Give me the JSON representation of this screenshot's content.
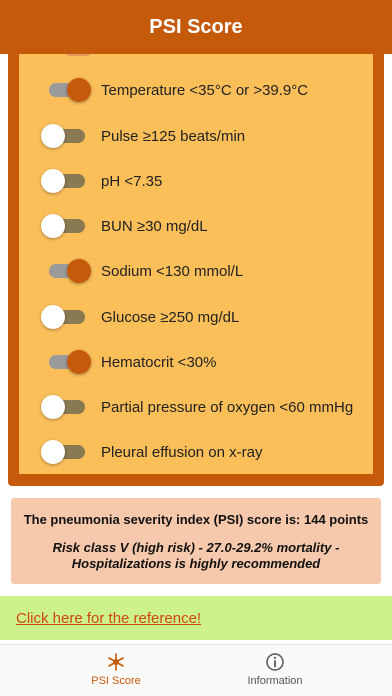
{
  "navbar": {
    "title": "PSI Score"
  },
  "criteria": [
    {
      "label": "Temperature <35°C or >39.9°C",
      "on": true
    },
    {
      "label": "Pulse ≥125 beats/min",
      "on": false
    },
    {
      "label": "pH <7.35",
      "on": false
    },
    {
      "label": "BUN ≥30 mg/dL",
      "on": false
    },
    {
      "label": "Sodium <130 mmol/L",
      "on": true
    },
    {
      "label": "Glucose ≥250 mg/dL",
      "on": false
    },
    {
      "label": "Hematocrit <30%",
      "on": true
    },
    {
      "label": "Partial pressure of oxygen <60 mmHg",
      "on": false
    },
    {
      "label": "Pleural effusion on x-ray",
      "on": false
    }
  ],
  "result": {
    "score_text": "The pneumonia severity index (PSI) score is: 144 points",
    "risk_text": "Risk class V (high risk) - 27.0-29.2% mortality - Hospitalizations is highly recommended"
  },
  "reference": {
    "link_text": "Click here for the reference!"
  },
  "tabbar": {
    "tabs": [
      {
        "label": "PSI Score",
        "icon": "asterisk-icon",
        "active": true
      },
      {
        "label": "Information",
        "icon": "info-circle-icon",
        "active": false
      }
    ]
  },
  "colors": {
    "brand": "#c55a0b",
    "panel": "#fbbf5a",
    "result_bg": "#f6c9ad",
    "reference_bg": "#cdf28c",
    "link": "#d0470a"
  }
}
